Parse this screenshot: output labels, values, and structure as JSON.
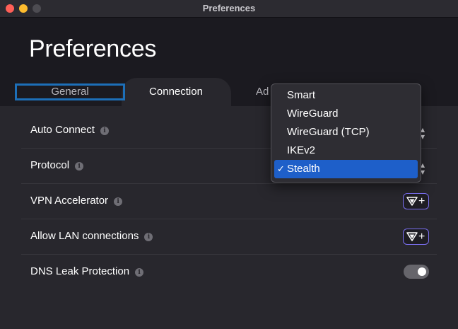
{
  "window": {
    "title": "Preferences"
  },
  "page": {
    "title": "Preferences"
  },
  "tabs": [
    {
      "label": "General"
    },
    {
      "label": "Connection"
    },
    {
      "label": "Ad"
    }
  ],
  "settings": [
    {
      "label": "Auto Connect",
      "control": "select"
    },
    {
      "label": "Protocol",
      "control": "select",
      "value": "Stealth"
    },
    {
      "label": "VPN Accelerator",
      "control": "upsell",
      "upsell_label": "+"
    },
    {
      "label": "Allow LAN connections",
      "control": "upsell",
      "upsell_label": "+"
    },
    {
      "label": "DNS Leak Protection",
      "control": "toggle",
      "enabled": true
    }
  ],
  "protocol_menu": {
    "options": [
      "Smart",
      "WireGuard",
      "WireGuard (TCP)",
      "IKEv2",
      "Stealth"
    ],
    "selected": "Stealth",
    "check": "✓"
  },
  "icons": {
    "info": "info-icon",
    "stepper": "chevron-up-down-icon",
    "shield": "shield-icon"
  },
  "colors": {
    "selection": "#1e5fc9",
    "tab_focus": "#1d6fb8",
    "upsell_border": "#7a6ff0"
  }
}
